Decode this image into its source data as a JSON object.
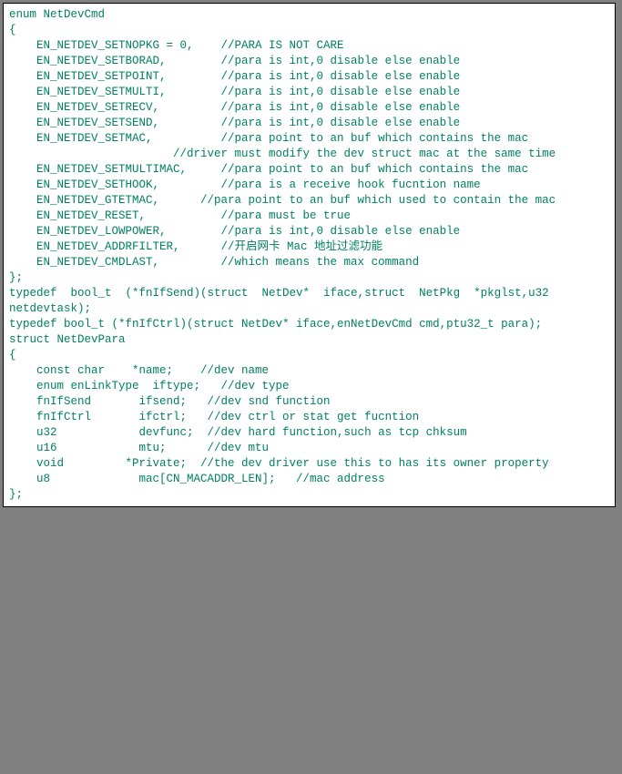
{
  "code": {
    "lines": [
      "enum NetDevCmd",
      "{",
      "    EN_NETDEV_SETNOPKG = 0,    //PARA IS NOT CARE",
      "    EN_NETDEV_SETBORAD,        //para is int,0 disable else enable",
      "    EN_NETDEV_SETPOINT,        //para is int,0 disable else enable",
      "    EN_NETDEV_SETMULTI,        //para is int,0 disable else enable",
      "    EN_NETDEV_SETRECV,         //para is int,0 disable else enable",
      "    EN_NETDEV_SETSEND,         //para is int,0 disable else enable",
      "    EN_NETDEV_SETMAC,          //para point to an buf which contains the mac",
      "                        //driver must modify the dev struct mac at the same time",
      "    EN_NETDEV_SETMULTIMAC,     //para point to an buf which contains the mac",
      "    EN_NETDEV_SETHOOK,         //para is a receive hook fucntion name",
      "    EN_NETDEV_GTETMAC,      //para point to an buf which used to contain the mac",
      "    EN_NETDEV_RESET,           //para must be true",
      "    EN_NETDEV_LOWPOWER,        //para is int,0 disable else enable",
      "    EN_NETDEV_ADDRFILTER,      //开启网卡 Mac 地址过滤功能",
      "    EN_NETDEV_CMDLAST,         //which means the max command",
      "};",
      "typedef  bool_t  (*fnIfSend)(struct  NetDev*  iface,struct  NetPkg  *pkglst,u32 ",
      "netdevtask);",
      "typedef bool_t (*fnIfCtrl)(struct NetDev* iface,enNetDevCmd cmd,ptu32_t para);",
      "struct NetDevPara",
      "{",
      "    const char    *name;    //dev name",
      "    enum enLinkType  iftype;   //dev type",
      "    fnIfSend       ifsend;   //dev snd function",
      "    fnIfCtrl       ifctrl;   //dev ctrl or stat get fucntion",
      "    u32            devfunc;  //dev hard function,such as tcp chksum",
      "    u16            mtu;      //dev mtu",
      "    void         *Private;  //the dev driver use this to has its owner property",
      "    u8             mac[CN_MACADDR_LEN];   //mac address",
      "};"
    ]
  }
}
